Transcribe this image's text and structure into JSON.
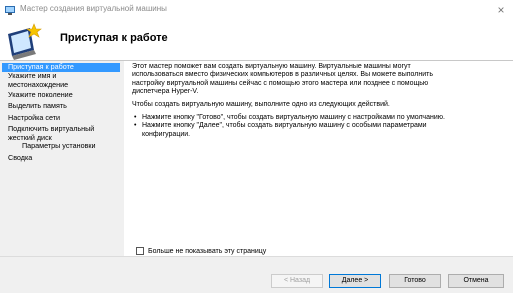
{
  "window": {
    "title": "Мастер создания виртуальной машины",
    "close_glyph": "×"
  },
  "header": {
    "title": "Приступая к работе",
    "icon": "virtual-machine-wizard-icon"
  },
  "sidebar": {
    "items": [
      {
        "label": "Приступая к работе"
      },
      {
        "label": "Укажите имя и"
      },
      {
        "label": "местонахождение"
      },
      {
        "label": "Укажите поколение"
      },
      {
        "label": "Выделить память"
      },
      {
        "label": "Настройка сети"
      },
      {
        "label": "Подключить виртуальный"
      },
      {
        "label": "жесткий диск"
      },
      {
        "label": "Параметры установки"
      },
      {
        "label": "Сводка"
      }
    ]
  },
  "content": {
    "para1_line1": "Этот мастер поможет вам создать виртуальную машину. Виртуальные машины могут",
    "para1_line2": "использоваться вместо физических компьютеров в различных целях. Вы можете выполнить",
    "para1_line3": "настройку виртуальной машины сейчас с помощью этого мастера или позднее с помощью",
    "para1_line4": "диспетчера Hyper-V.",
    "para2": "Чтобы создать виртуальную машину, выполните одно из следующих действий.",
    "bullet1": "Нажмите кнопку \"Готово\", чтобы создать виртуальную машину с настройками по умолчанию.",
    "bullet2_line1": "Нажмите кнопку \"Далее\", чтобы создать виртуальную машину с особыми параметрами",
    "bullet2_line2": "конфигурации.",
    "bullet_glyph": "•",
    "checkbox_label": "Больше не показывать эту страницу",
    "checkbox_checked": false
  },
  "footer": {
    "back_label": "< Назад",
    "next_label": "Далее >",
    "finish_label": "Готово",
    "cancel_label": "Отмена"
  }
}
